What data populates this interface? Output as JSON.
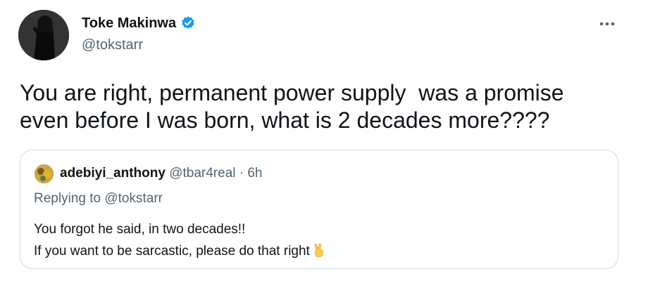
{
  "tweet": {
    "author": {
      "name": "Toke Makinwa",
      "handle": "@tokstarr",
      "verified": true
    },
    "text": "You are right, permanent power supply  was a promise\neven before I was born, what is 2 decades more????",
    "quoted": {
      "author_name": "adebiyi_anthony",
      "meta": "@tbar4real · 6h",
      "replying_to": "Replying to @tokstarr",
      "text_line1": "You forgot he said, in two decades!!",
      "text_line2": "If you want to be sarcastic, please do that right",
      "emoji": "victory-hand"
    }
  },
  "colors": {
    "text_primary": "#0f1419",
    "text_secondary": "#536471",
    "verified_blue": "#1d9bf0",
    "border": "#cfd9de"
  }
}
